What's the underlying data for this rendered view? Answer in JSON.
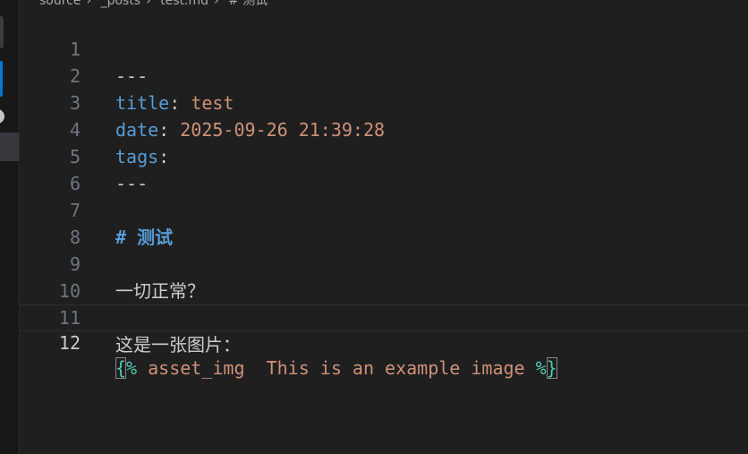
{
  "breadcrumb": {
    "items": [
      "source",
      "_posts",
      "test.md",
      "# 测试"
    ]
  },
  "lines": [
    {
      "num": "1",
      "key": "",
      "sep": "",
      "value": "---",
      "type": "plain-code"
    },
    {
      "num": "2",
      "key": "title",
      "sep": ": ",
      "value": "test"
    },
    {
      "num": "3",
      "key": "date",
      "sep": ": ",
      "value": "2025-09-26 21:39:28"
    },
    {
      "num": "4",
      "key": "tags",
      "sep": ":",
      "value": ""
    },
    {
      "num": "5",
      "value": "---"
    },
    {
      "num": "6",
      "value": ""
    },
    {
      "num": "7",
      "value": "# 测试"
    },
    {
      "num": "8",
      "value": ""
    },
    {
      "num": "9",
      "value": "一切正常？"
    },
    {
      "num": "10",
      "value": ""
    },
    {
      "num": "11",
      "value": "这是一张图片："
    },
    {
      "num": "12",
      "open_brace": "{",
      "open_pct": "%",
      "body": " asset_img  This is an example image ",
      "close_pct": "%",
      "close_brace": "}"
    }
  ]
}
